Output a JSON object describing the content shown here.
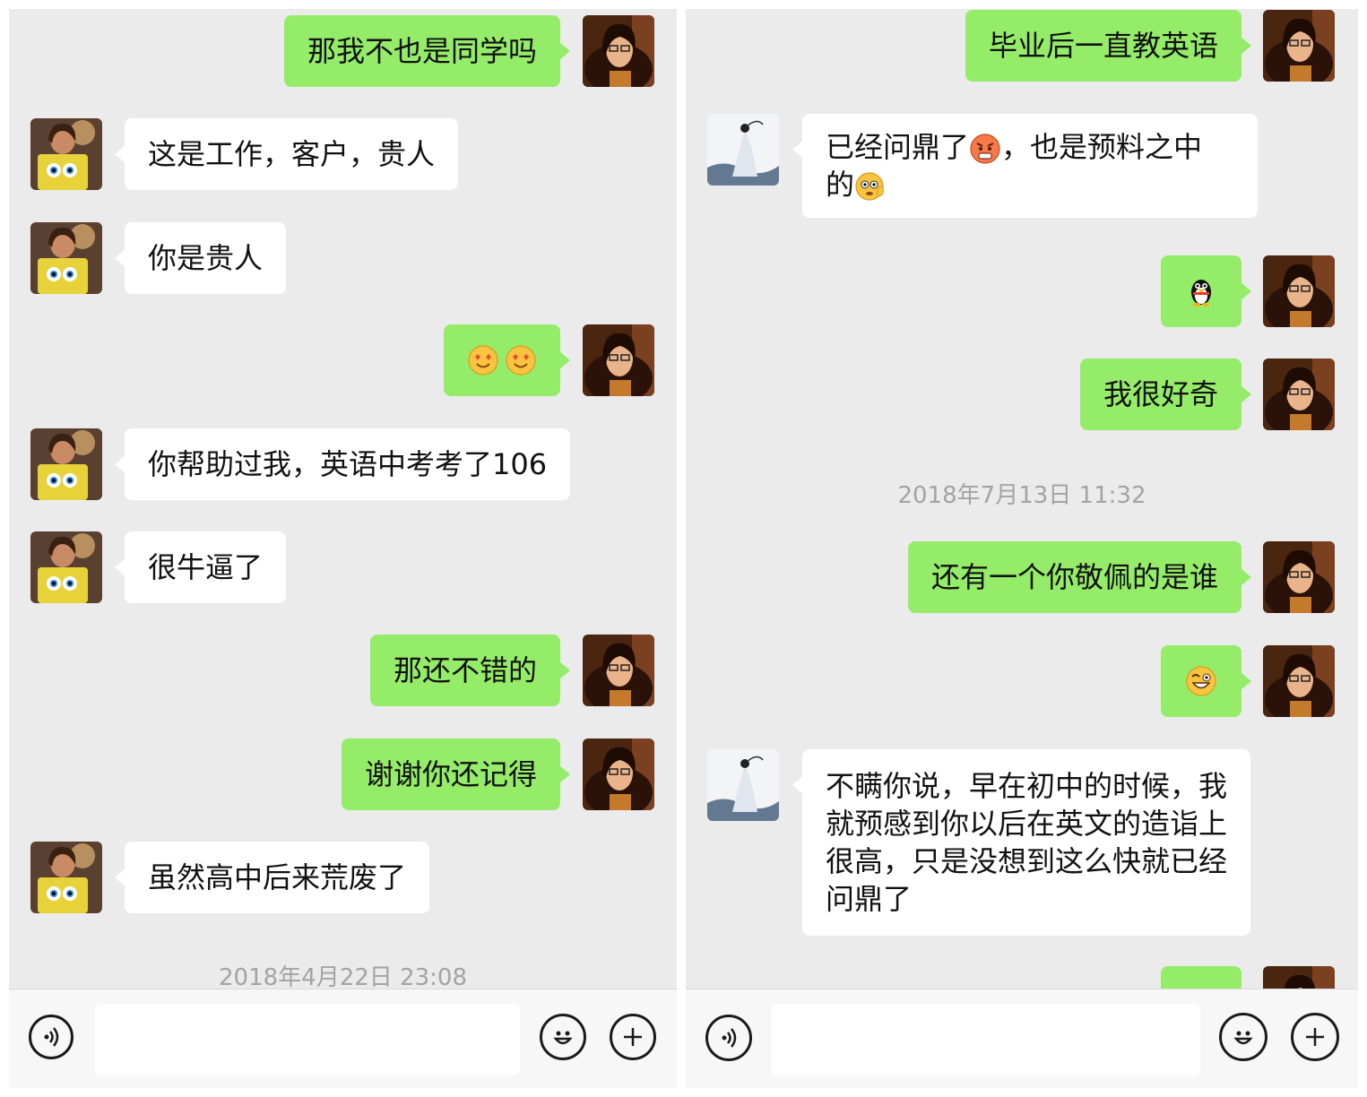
{
  "left_chat": {
    "messages": [
      {
        "text": "那我不也是同学吗"
      },
      {
        "text": "这是工作，客户，贵人"
      },
      {
        "text": "你是贵人"
      },
      {
        "emoji": [
          "smiling-heart-eyes-emoji",
          "smiling-heart-eyes-emoji"
        ]
      },
      {
        "text": "你帮助过我，英语中考考了106"
      },
      {
        "text": "很牛逼了"
      },
      {
        "text": "那还不错的"
      },
      {
        "text": "谢谢你还记得"
      },
      {
        "text": "虽然高中后来荒废了"
      }
    ],
    "timestamp": "2018年4月22日 23:08"
  },
  "right_chat": {
    "messages": [
      {
        "text": "毕业后一直教英语"
      },
      {
        "text_a": "已经问鼎了",
        "text_b": "，也是预料之中",
        "text_c": "的",
        "emojis": [
          "angry-red-face-emoji",
          "salute-face-emoji"
        ]
      },
      {
        "emoji": "penguin-emoji"
      },
      {
        "text": "我很好奇"
      },
      {
        "text": "还有一个你敬佩的是谁"
      },
      {
        "emoji": "winking-grin-emoji"
      },
      {
        "text": "不瞒你说，早在初中的时候，我就预感到你以后在英文的造诣上很高，只是没想到这么快就已经问鼎了"
      }
    ],
    "timestamp": "2018年7月13日 11:32"
  },
  "colors": {
    "chat_background": "#ebebeb",
    "outgoing_bubble": "#95ec69",
    "incoming_bubble": "#ffffff",
    "timestamp_text": "#a3a3a3",
    "input_bar": "#f7f7f7"
  },
  "icons": {
    "voice": "voice-icon",
    "emoji": "emoji-face-icon",
    "more": "plus-icon"
  }
}
